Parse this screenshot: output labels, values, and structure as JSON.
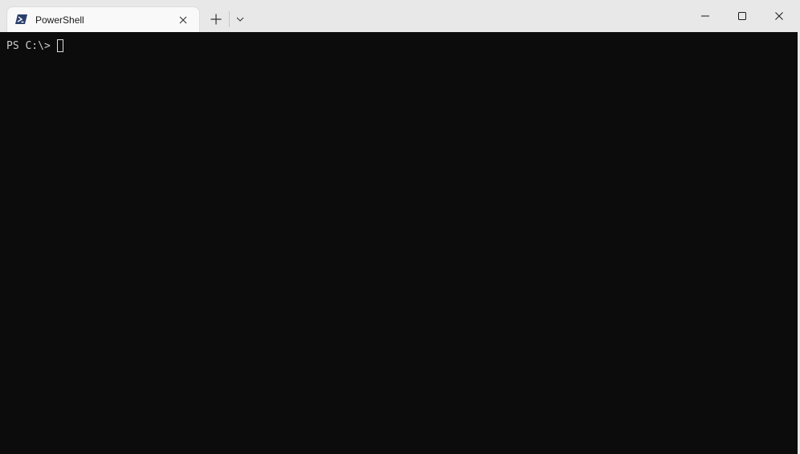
{
  "window": {
    "tab_title": "PowerShell",
    "tab_icon": "powershell-icon"
  },
  "terminal": {
    "prompt": "PS C:\\> ",
    "background": "#0c0c0c",
    "foreground": "#cccccc"
  },
  "icons": {
    "close_tab": "close-icon",
    "new_tab": "plus-icon",
    "dropdown": "chevron-down-icon",
    "minimize": "minimize-icon",
    "maximize": "maximize-icon",
    "close_window": "close-icon"
  }
}
